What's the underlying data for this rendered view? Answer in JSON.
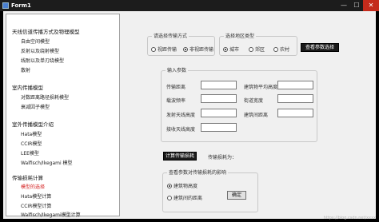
{
  "window": {
    "title": "Form1",
    "controls": [
      "—",
      "☐",
      "✕"
    ]
  },
  "tree": {
    "categories": [
      {
        "label": "天线信道传播方式及物理模型",
        "items": [
          "自由空间模型",
          "反射以及绕射模型",
          "线耐以及单刃绕模型",
          "散射"
        ]
      },
      {
        "label": "室内传播模型",
        "items": [
          "对数距离路径损耗模型",
          "衰减因子模型"
        ]
      },
      {
        "label": "室外传播模型介绍",
        "items": [
          "Hata模型",
          "CCIR模型",
          "LEE模型",
          "Walfisch/Ikegami 模型"
        ]
      },
      {
        "label": "传输损耗计算",
        "items": [
          "模型的选择",
          "Hata模型计算",
          "CCIR模型计算",
          "Walfisch/Ikegami模型计算"
        ]
      }
    ]
  },
  "transmission": {
    "legend": "请选择传输方式",
    "options": [
      "视距传输",
      "非视距传输"
    ],
    "selected": 1
  },
  "area": {
    "legend": "选择地区类型",
    "options": [
      "城市",
      "郊区",
      "农村"
    ],
    "selected": 0
  },
  "buttons": {
    "view_params": "查看参数选择",
    "calc": "计算传输损耗",
    "confirm": "确定"
  },
  "params": {
    "legend": "输入参数",
    "left_fields": [
      "传输距离",
      "载波频率",
      "发射天线高度",
      "接收天线高度"
    ],
    "right_fields": [
      "建筑物平均高度",
      "街道宽度",
      "建筑间距离"
    ]
  },
  "result": {
    "label": "传输损耗为："
  },
  "view": {
    "legend": "查看参数对传输损耗的影响",
    "options": [
      "建筑物高度",
      "建筑间的距离"
    ],
    "selected": 0
  },
  "watermark": "https://blog.csdn.net/xxxx"
}
